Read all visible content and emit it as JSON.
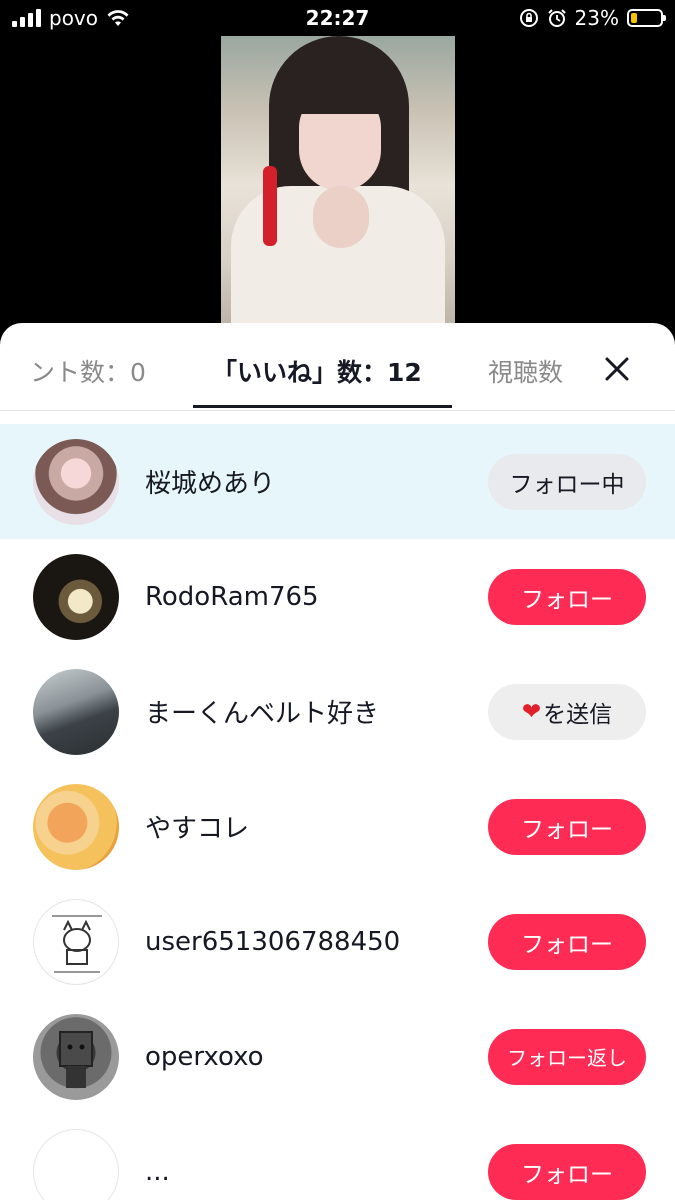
{
  "status_bar": {
    "carrier": "povo",
    "time": "22:27",
    "battery": "23%",
    "battery_level": 0.23
  },
  "tabs": {
    "gifts": "ント数：0",
    "likes": "「いいね」数：12",
    "views": "視聴数"
  },
  "users": [
    {
      "name": "桜城めあり",
      "action": "フォロー中"
    },
    {
      "name": "RodoRam765",
      "action": "フォロー"
    },
    {
      "name": "まーくんベルト好き",
      "action": "を送信",
      "heart": "❤"
    },
    {
      "name": "やすコレ",
      "action": "フォロー"
    },
    {
      "name": "user651306788450",
      "action": "フォロー"
    },
    {
      "name": "operxoxo",
      "action": "フォロー返し"
    },
    {
      "name": "...",
      "action": "フォロー"
    }
  ],
  "colors": {
    "accent": "#fe2c55",
    "highlight_row": "#e6f6fb"
  }
}
